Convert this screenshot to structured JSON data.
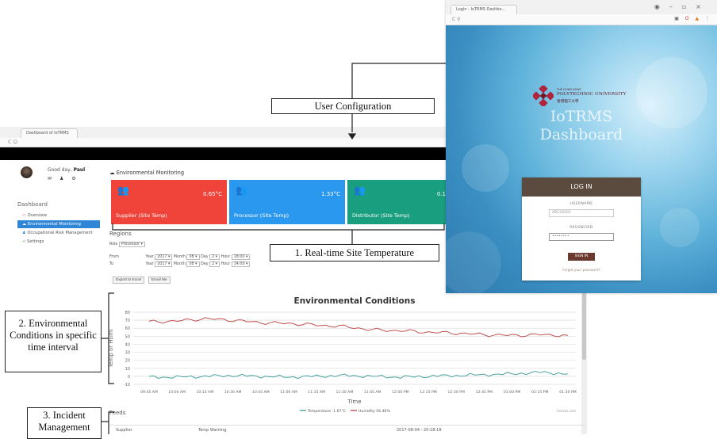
{
  "dashboard": {
    "tab_title": "Dashboard of IoTRMS",
    "address": "C  ☺",
    "user": {
      "greeting": "Good day,",
      "name": "Paul"
    },
    "sidebar_title": "Dashboard",
    "sidebar_items": [
      {
        "label": "Overview",
        "color": "#d9534f"
      },
      {
        "label": "Environmental Monitoring",
        "color": "#ffffff"
      },
      {
        "label": "Occupational Risk Management",
        "color": "#2f86d6"
      },
      {
        "label": "Settings",
        "color": "#5cb85c"
      }
    ],
    "section_title": "Environmental Monitoring",
    "cards": [
      {
        "label": "Supplier (Site Temp)",
        "value": "0.65°C",
        "color": "#f0433a"
      },
      {
        "label": "Processor (Site Temp)",
        "value": "1.33°C",
        "color": "#2b98f0"
      },
      {
        "label": "Distributor (Site Temp)",
        "value": "0.1",
        "color": "#1a9e80"
      }
    ],
    "regions": {
      "title": "Regions",
      "role_label": "Role",
      "role_value": "Processor",
      "from_label": "From",
      "to_label": "To",
      "from": {
        "year": "2017",
        "month": "08",
        "day": "2",
        "hour": "18:00"
      },
      "to": {
        "year": "2017",
        "month": "08",
        "day": "2",
        "hour": "14:00"
      },
      "year_label": "Year",
      "month_label": "Month",
      "day_label": "Day",
      "hour_label": "Hour",
      "export_button": "Export to Excel",
      "email_button": "Email Me"
    },
    "feeds": {
      "title": "Feeds",
      "row": {
        "source": "Supplier",
        "type": "Temp Warning",
        "time": "2017-08-04 - 20:18:18"
      }
    }
  },
  "chart_data": {
    "type": "line",
    "title": "Environmental Conditions",
    "xlabel": "Time",
    "ylabel": "Temp or Humi",
    "ylim": [
      -10,
      80
    ],
    "yticks": [
      -10,
      0,
      10,
      20,
      30,
      40,
      50,
      60,
      70,
      80
    ],
    "categories": [
      "09:45 AM",
      "10:00 AM",
      "10:15 AM",
      "10:30 AM",
      "10:45 AM",
      "11:00 AM",
      "11:15 AM",
      "11:30 AM",
      "11:45 AM",
      "12:00 PM",
      "12:15 PM",
      "12:30 PM",
      "12:45 PM",
      "01:00 PM",
      "01:15 PM",
      "01:30 PM"
    ],
    "grid": true,
    "legend": "bottom",
    "credit": "Canvas.com",
    "series": [
      {
        "name": "Temperature -1.67°C",
        "color": "#4aa3a0",
        "values": [
          -1,
          -1,
          0,
          1,
          0,
          -1,
          0,
          1,
          0,
          -1,
          0,
          1,
          2,
          3,
          5,
          3
        ]
      },
      {
        "name": "Humidity 56.46%",
        "color": "#c0504d",
        "values": [
          68,
          69,
          72,
          70,
          67,
          66,
          64,
          62,
          58,
          57,
          55,
          54,
          52,
          51,
          52,
          51
        ]
      }
    ]
  },
  "login": {
    "tab_title": "Login - IoTRMS Dashbo...",
    "address": "C  ⚲",
    "university_line1": "THE HONG KONG",
    "university_line2": "POLYTECHNIC UNIVERSITY",
    "university_chinese": "香港理工大學",
    "app_line1": "IoTRMS",
    "app_line2": "Dashboard",
    "header": "LOG IN",
    "username_label": "USERNAME",
    "username_value": "ABC00001",
    "password_label": "PASSWORD",
    "password_value": "••••••••",
    "sign_in": "SIGN IN",
    "forgot": "Forgot your password?"
  },
  "annotations": {
    "user_config": "User Configuration",
    "realtime": "1. Real-time Site Temperature",
    "env_conditions": "2. Environmental Conditions in specific time interval",
    "incident": "3. Incident Management"
  }
}
